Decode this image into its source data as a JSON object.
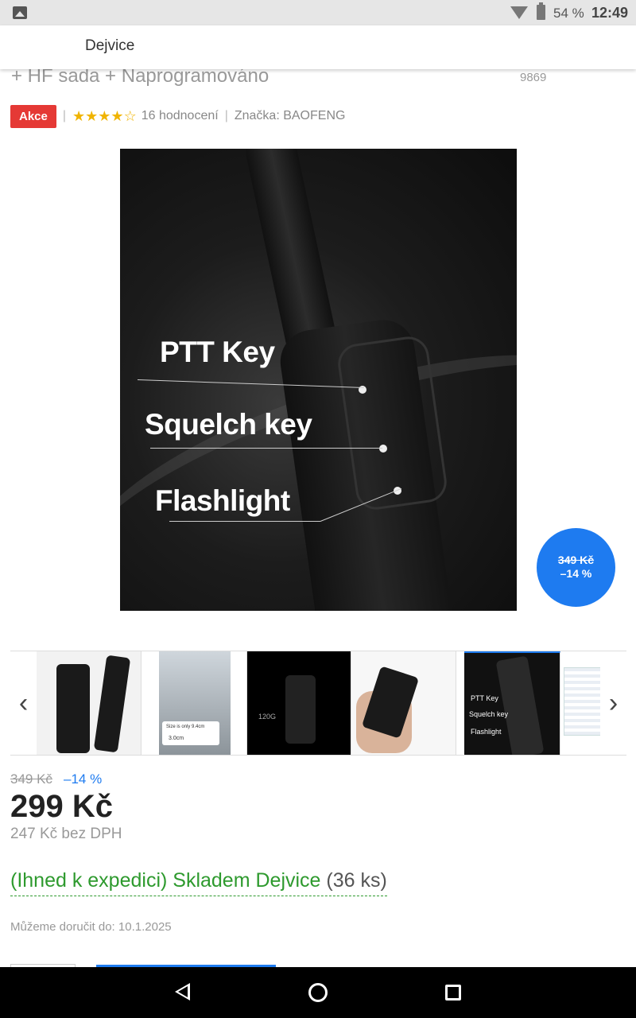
{
  "status_bar": {
    "battery": "54 %",
    "time": "12:49"
  },
  "header": {
    "store": "Dejvice"
  },
  "product": {
    "title_fragment": "+ HF sada + Naprogramováno",
    "code_fragment": "9869",
    "sale_tag": "Akce",
    "stars": "★★★★☆",
    "rating_text": "16 hodnocení",
    "brand": "Značka: BAOFENG",
    "rating_value": 4.5
  },
  "main_image": {
    "labels": [
      "PTT Key",
      "Squelch key",
      "Flashlight"
    ]
  },
  "badge": {
    "old_price": "349 Kč",
    "discount": "–14 %"
  },
  "gallery": {
    "thumbs": [
      {
        "name": "thumb-1"
      },
      {
        "name": "thumb-2",
        "caption_1": "Size is only 9.4cm",
        "caption_2": "3.0cm"
      },
      {
        "name": "thumb-3",
        "caption": "120G"
      },
      {
        "name": "thumb-4"
      },
      {
        "name": "thumb-5",
        "labels": [
          "PTT Key",
          "Squelch key",
          "Flashlight"
        ]
      },
      {
        "name": "thumb-6"
      }
    ]
  },
  "pricing": {
    "old_price": "349 Kč",
    "discount": "–14 %",
    "price": "299 Kč",
    "price_without_vat": "247 Kč bez DPH"
  },
  "availability": {
    "stock_text": "(Ihned k expedici) Skladem Dejvice",
    "quantity": " (36 ks)",
    "delivery": "Můžeme doručit do: 10.1.2025"
  },
  "colors": {
    "accent": "#1e7bf0",
    "sale": "#e53935",
    "stock": "#2e9a2e",
    "stars": "#f0b400"
  }
}
